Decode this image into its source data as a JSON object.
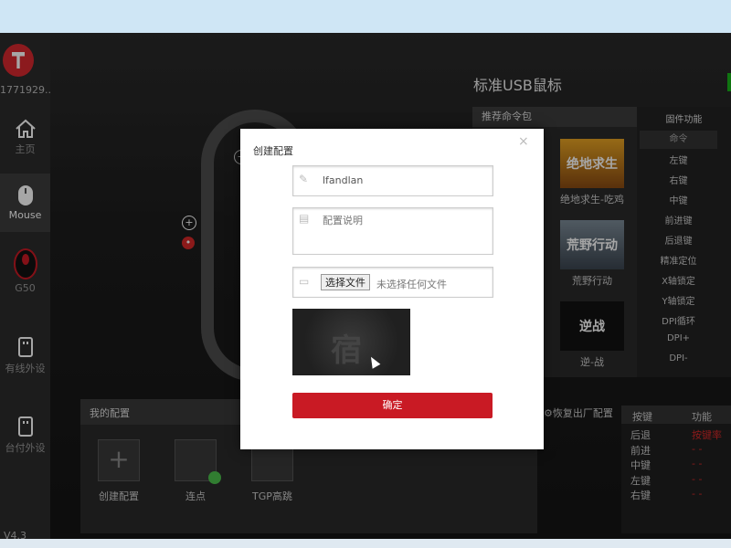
{
  "sidebar": {
    "user_id": "1771929...",
    "nav": [
      {
        "label": "主页",
        "icon": "home-icon"
      },
      {
        "label": "Mouse",
        "icon": "mouse-icon"
      },
      {
        "label": "G50",
        "icon": "mouse-device-icon"
      },
      {
        "label": "有线外设",
        "icon": "usb-icon"
      },
      {
        "label": "台付外设",
        "icon": "usb-icon"
      }
    ],
    "version": "V4.3"
  },
  "device": {
    "title": "标准USB鼠标",
    "recommended_header": "推荐命令包",
    "games": [
      {
        "label": "绝地求生-吃鸡",
        "img_text": "绝地求生"
      },
      {
        "label": "荒野行动",
        "img_text": "荒野行动"
      },
      {
        "label": "逆-战",
        "img_text": "逆战"
      }
    ],
    "firmware_header": "固件功能",
    "command_col": "命令",
    "commands": [
      "左键",
      "右键",
      "中键",
      "前进键",
      "后退键",
      "精准定位",
      "X轴锁定",
      "Y轴锁定",
      "DPI循环",
      "DPI+",
      "DPI-"
    ]
  },
  "my_config": {
    "title": "我的配置",
    "items": [
      {
        "label": "创建配置"
      },
      {
        "label": "连点"
      },
      {
        "label": "TGP高跳"
      }
    ],
    "restore_label": "恢复出厂配置"
  },
  "key_table": {
    "headers": [
      "按键",
      "功能"
    ],
    "rows": [
      {
        "key": "后退",
        "func": "按键率"
      },
      {
        "key": "前进",
        "func": "- -"
      },
      {
        "key": "中键",
        "func": "- -"
      },
      {
        "key": "左键",
        "func": "- -"
      },
      {
        "key": "右键",
        "func": "- -"
      }
    ]
  },
  "dialog": {
    "title": "创建配置",
    "close": "×",
    "name_value": "lfandlan",
    "desc_placeholder": "配置说明",
    "file_button": "选择文件",
    "file_status": "未选择任何文件",
    "preview_text": "宿",
    "confirm": "确定"
  },
  "colors": {
    "accent": "#c91a24",
    "sidebar_bg": "#2b2b2b",
    "status_green": "#18b31a"
  }
}
